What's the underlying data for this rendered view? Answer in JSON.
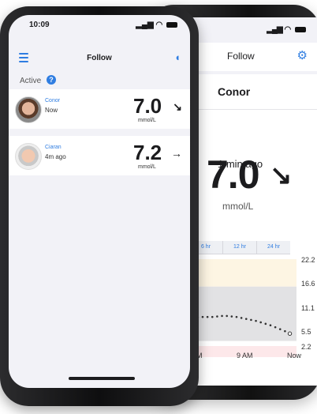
{
  "front": {
    "status_time": "10:09",
    "header_title": "Follow",
    "section_label": "Active",
    "help_glyph": "?",
    "followers": [
      {
        "name": "Conor",
        "time": "Now",
        "value": "7.0",
        "unit": "mmol/L",
        "trend_icon": "arrow-down-right-icon",
        "trend": "↘"
      },
      {
        "name": "Ciaran",
        "time": "4m ago",
        "value": "7.2",
        "unit": "mmol/L",
        "trend_icon": "arrow-right-icon",
        "trend": "→"
      }
    ]
  },
  "back": {
    "header_title": "Follow",
    "name": "Conor",
    "ago": "1 min ago",
    "value": "7.0",
    "unit": "mmol/L",
    "trend": "↘",
    "tabs": [
      "",
      "6 hr",
      "12 hr",
      "24 hr"
    ]
  },
  "colors": {
    "accent": "#2f7de1",
    "high_band": "#fdf5e3",
    "target_band": "#e2e2e4",
    "low_band": "#fde8ea"
  },
  "chart_data": {
    "type": "scatter",
    "y_ticks": [
      "22.2",
      "16.6",
      "11.1",
      "5.5",
      "2.2"
    ],
    "x_ticks": [
      "8 AM",
      "9 AM",
      "Now"
    ],
    "ylim": [
      2.2,
      22.2
    ],
    "target_range": [
      5.5,
      16.6
    ],
    "x": [
      "07:58",
      "08:03",
      "08:08",
      "08:13",
      "08:18",
      "08:23",
      "08:28",
      "08:33",
      "08:38",
      "08:43",
      "08:48",
      "08:53",
      "08:58",
      "09:03",
      "09:08",
      "09:13",
      "09:18",
      "09:23",
      "09:28",
      "09:33",
      "09:38",
      "09:43",
      "09:48",
      "09:53",
      "09:58",
      "10:03",
      "10:08"
    ],
    "values": [
      8.6,
      8.9,
      9.2,
      9.5,
      9.8,
      10.0,
      10.2,
      10.3,
      10.4,
      10.4,
      10.4,
      10.5,
      10.6,
      10.6,
      10.5,
      10.4,
      10.2,
      10.0,
      9.8,
      9.6,
      9.3,
      9.0,
      8.7,
      8.3,
      7.9,
      7.5,
      7.0
    ]
  }
}
